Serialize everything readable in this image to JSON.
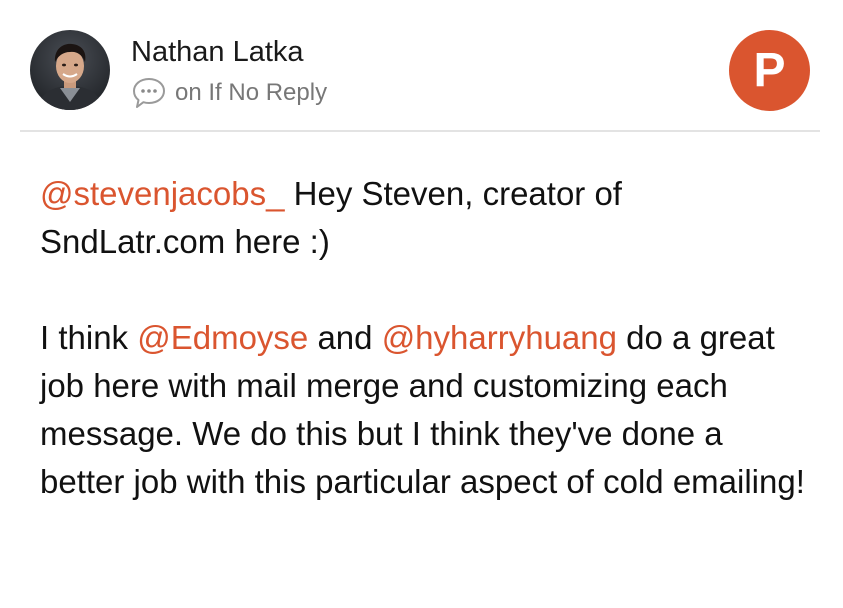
{
  "post": {
    "author": {
      "name": "Nathan Latka",
      "avatar_icon": "profile-photo"
    },
    "meta": {
      "icon": "comment-bubble-icon",
      "text": "on If No Reply"
    },
    "brand": {
      "icon": "product-hunt-logo",
      "letter": "P",
      "color": "#da552f"
    },
    "paragraph1": {
      "mention": "@stevenjacobs_",
      "text": " Hey Steven, creator of SndLatr.com here :)"
    },
    "paragraph2": {
      "text_a": "I think ",
      "mention_a": "@Edmoyse",
      "text_b": " and ",
      "mention_b": "@hyharryhuang",
      "text_c": " do a great job here with mail merge and customizing each message. We do this but I think they've done a better job with this particular aspect of cold emailing!"
    },
    "accent_color": "#da552f",
    "mention_color": "#da552f",
    "text_color": "#111111",
    "meta_color": "#777777"
  }
}
